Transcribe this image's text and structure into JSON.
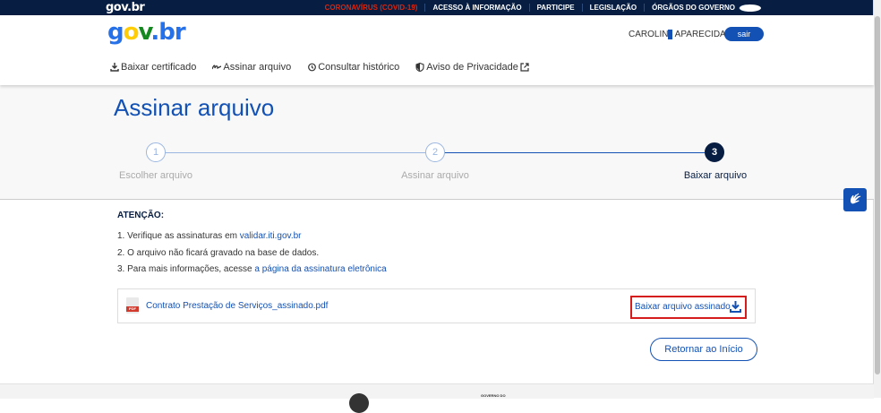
{
  "topbar": {
    "logo": "gov.br",
    "links": [
      "CORONAVÍRUS (COVID-19)",
      "ACESSO À INFORMAÇÃO",
      "PARTICIPE",
      "LEGISLAÇÃO",
      "ÓRGÃOS DO GOVERNO"
    ]
  },
  "header": {
    "user_before": "CAROLIN",
    "user_after": " APARECIDA A..",
    "logout": "sair"
  },
  "nav": [
    "Baixar certificado",
    "Assinar arquivo",
    "Consultar histórico",
    "Aviso de Privacidade"
  ],
  "page_title": "Assinar arquivo",
  "steps": [
    {
      "number": "1",
      "label": "Escolher arquivo"
    },
    {
      "number": "2",
      "label": "Assinar arquivo"
    },
    {
      "number": "3",
      "label": "Baixar arquivo"
    }
  ],
  "attention": {
    "heading": "ATENÇÃO:",
    "item1_text": "1. Verifique as assinaturas em ",
    "item1_link": "validar.iti.gov.br",
    "item2_text": "2. O arquivo não ficará gravado na base de dados.",
    "item3_text": "3. Para mais informações, acesse ",
    "item3_link": "a página da assinatura eletrônica"
  },
  "file": {
    "icon_tag": "PDF",
    "name": "Contrato Prestação de Serviços_assinado.pdf",
    "download_label": "Baixar arquivo assinado"
  },
  "return_button": "Retornar ao Início",
  "footer": {
    "gov_text": "GOVERNO DO"
  }
}
